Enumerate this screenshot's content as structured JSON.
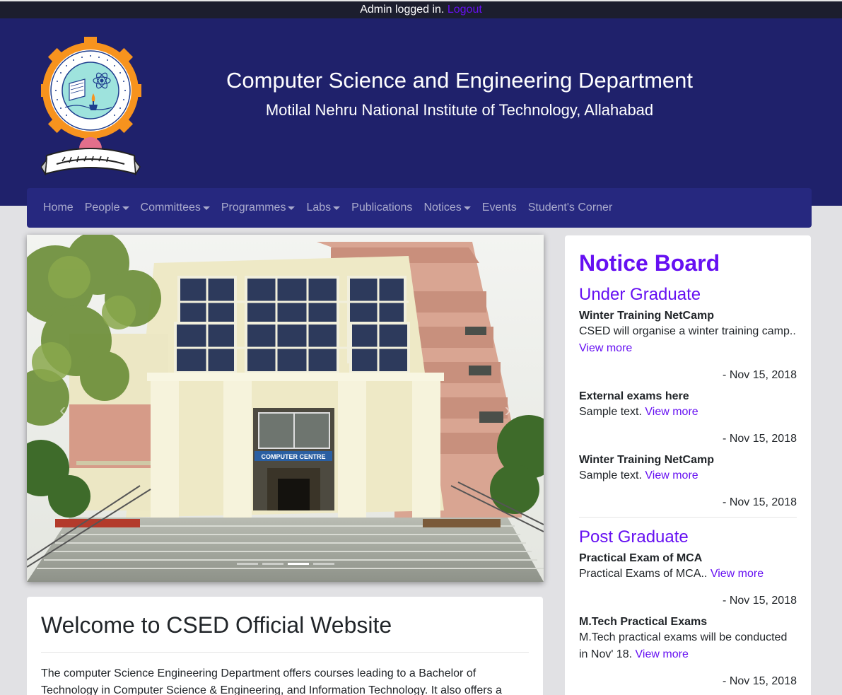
{
  "topbar": {
    "status_text": "Admin logged in.",
    "logout_label": "Logout"
  },
  "header": {
    "title": "Computer Science and Engineering Department",
    "subtitle": "Motilal Nehru National Institute of Technology, Allahabad"
  },
  "nav": {
    "items": [
      {
        "label": "Home",
        "dropdown": false
      },
      {
        "label": "People",
        "dropdown": true
      },
      {
        "label": "Committees",
        "dropdown": true
      },
      {
        "label": "Programmes",
        "dropdown": true
      },
      {
        "label": "Labs",
        "dropdown": true
      },
      {
        "label": "Publications",
        "dropdown": false
      },
      {
        "label": "Notices",
        "dropdown": true
      },
      {
        "label": "Events",
        "dropdown": false
      },
      {
        "label": "Student's Corner",
        "dropdown": false
      }
    ]
  },
  "carousel": {
    "slide_count": 4,
    "active_index": 2,
    "building_sign": "COMPUTER CENTRE"
  },
  "welcome": {
    "heading": "Welcome to CSED Official Website",
    "body": "The computer Science Engineering Department offers courses leading to a Bachelor of Technology in Computer Science & Engineering, and Information Technology. It also offers a"
  },
  "notice_board": {
    "title": "Notice Board",
    "sections": [
      {
        "heading": "Under Graduate",
        "items": [
          {
            "title": "Winter Training NetCamp",
            "text": "CSED will organise a winter training camp..",
            "link": "View more",
            "date": "- Nov 15, 2018"
          },
          {
            "title": "External exams here",
            "text": "Sample text.",
            "link": "View more",
            "date": "- Nov 15, 2018"
          },
          {
            "title": "Winter Training NetCamp",
            "text": "Sample text.",
            "link": "View more",
            "date": "- Nov 15, 2018"
          }
        ]
      },
      {
        "heading": "Post Graduate",
        "items": [
          {
            "title": "Practical Exam of MCA",
            "text": "Practical Exams of MCA..",
            "link": "View more",
            "date": "- Nov 15, 2018"
          },
          {
            "title": "M.Tech Practical Exams",
            "text": "M.Tech practical exams will be conducted in Nov' 18.",
            "link": "View more",
            "date": "- Nov 15, 2018"
          }
        ]
      }
    ]
  },
  "colors": {
    "header_bg": "#1f216b",
    "navbar_bg": "#26287f",
    "accent": "#6610f2",
    "page_bg": "#e1e1e4"
  },
  "logo": {
    "motto": "सिद्धिर्भवति कर्मजा",
    "ring_text": "MOTILAL NEHRU NATIONAL INSTITUTE OF TECHNOLOGY",
    "city": "ALLAHABAD (INDIA)"
  }
}
